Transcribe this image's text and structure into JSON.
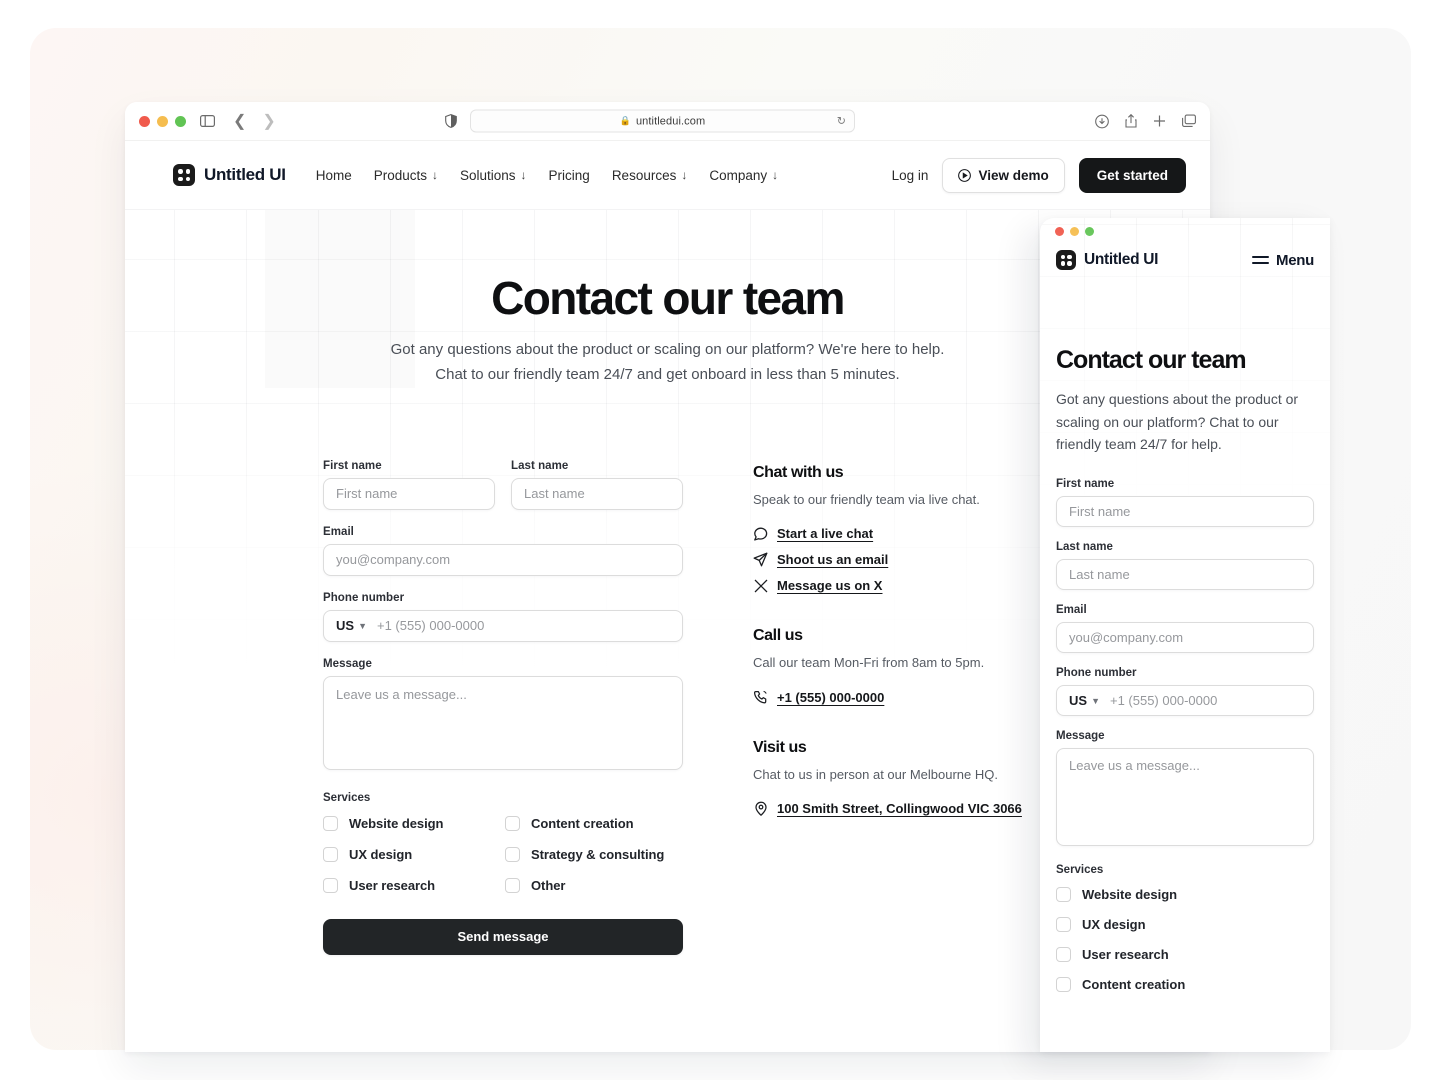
{
  "browser": {
    "url": "untitledui.com",
    "lock_icon": "lock-icon",
    "reload_icon": "reload-icon",
    "back_icon": "back-arrow-icon",
    "forward_icon": "forward-arrow-icon",
    "sidebar_icon": "sidebar-toggle-icon",
    "shield_icon": "privacy-shield-icon",
    "toolbar_icons": [
      "download-icon",
      "share-icon",
      "new-tab-icon",
      "tab-overview-icon"
    ]
  },
  "nav": {
    "brand": "Untitled UI",
    "links": [
      {
        "label": "Home",
        "caret": false
      },
      {
        "label": "Products",
        "caret": true
      },
      {
        "label": "Solutions",
        "caret": true
      },
      {
        "label": "Pricing",
        "caret": false
      },
      {
        "label": "Resources",
        "caret": true
      },
      {
        "label": "Company",
        "caret": true
      }
    ],
    "login": "Log in",
    "demo": "View demo",
    "start": "Get started"
  },
  "hero": {
    "title": "Contact our team",
    "line1": "Got any questions about the product or scaling on our platform? We're here to help.",
    "line2": "Chat to our friendly team 24/7 and get onboard in less than 5 minutes."
  },
  "form": {
    "first_name": {
      "label": "First name",
      "placeholder": "First name",
      "value": ""
    },
    "last_name": {
      "label": "Last name",
      "placeholder": "Last name",
      "value": ""
    },
    "email": {
      "label": "Email",
      "placeholder": "you@company.com",
      "value": ""
    },
    "phone": {
      "label": "Phone number",
      "country": "US",
      "placeholder": "+1 (555) 000-0000",
      "value": ""
    },
    "message": {
      "label": "Message",
      "placeholder": "Leave us a message...",
      "value": ""
    },
    "services_label": "Services",
    "services": [
      "Website design",
      "Content creation",
      "UX design",
      "Strategy & consulting",
      "User research",
      "Other"
    ],
    "submit": "Send message"
  },
  "contact": {
    "chat": {
      "title": "Chat with us",
      "sub": "Speak to our friendly team via live chat.",
      "links": [
        {
          "icon": "chat-bubble-icon",
          "label": "Start a live chat"
        },
        {
          "icon": "paper-plane-icon",
          "label": "Shoot us an email"
        },
        {
          "icon": "x-logo-icon",
          "label": "Message us on X"
        }
      ]
    },
    "call": {
      "title": "Call us",
      "sub": "Call our team Mon-Fri from 8am to 5pm.",
      "links": [
        {
          "icon": "phone-icon",
          "label": "+1 (555) 000-0000"
        }
      ]
    },
    "visit": {
      "title": "Visit us",
      "sub": "Chat to us in person at our Melbourne HQ.",
      "links": [
        {
          "icon": "map-pin-icon",
          "label": "100 Smith Street, Collingwood VIC 3066"
        }
      ]
    }
  },
  "mobile": {
    "brand": "Untitled UI",
    "menu": "Menu",
    "title": "Contact our team",
    "sub": "Got any questions about the product or scaling on our platform? Chat to our friendly team 24/7 for help.",
    "first_name": {
      "label": "First name",
      "placeholder": "First name"
    },
    "last_name": {
      "label": "Last name",
      "placeholder": "Last name"
    },
    "email": {
      "label": "Email",
      "placeholder": "you@company.com"
    },
    "phone": {
      "label": "Phone number",
      "country": "US",
      "placeholder": "+1 (555) 000-0000"
    },
    "message": {
      "label": "Message",
      "placeholder": "Leave us a message..."
    },
    "services_label": "Services",
    "services": [
      "Website design",
      "UX design",
      "User research",
      "Content creation"
    ]
  },
  "colors": {
    "brand_dark": "#151718",
    "page_bg": "#ffffff",
    "card_bg": "#faf8f5",
    "border": "#dcdcdc",
    "text": "#101828",
    "muted": "#4a4f57"
  }
}
